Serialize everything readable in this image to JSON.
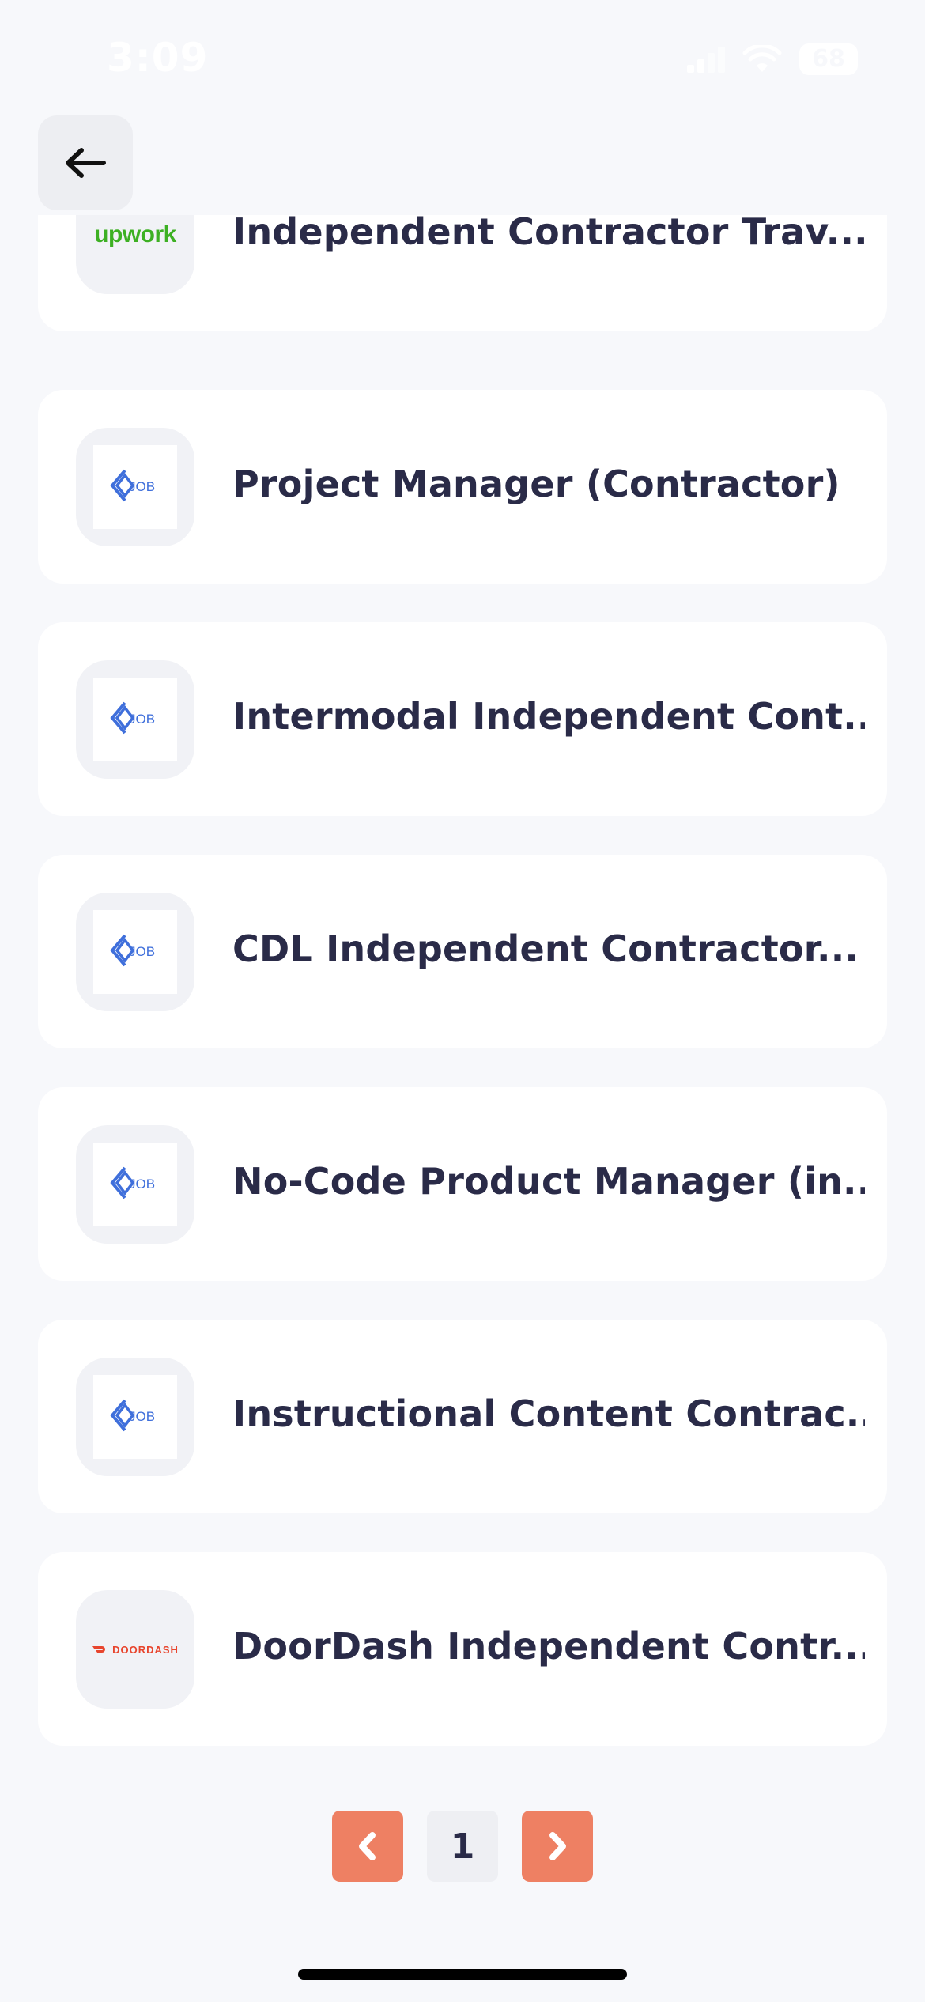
{
  "status_bar": {
    "time": "3:09",
    "battery": "68"
  },
  "header": {
    "back_icon": "arrow-left-icon"
  },
  "jobs": [
    {
      "title": "Independent Contractor Trav...",
      "logo": "upwork",
      "logo_text": "upwork"
    },
    {
      "title": "Project Manager (Contractor)",
      "logo": "job",
      "logo_text": "JOB"
    },
    {
      "title": "Intermodal Independent Cont...",
      "logo": "job",
      "logo_text": "JOB"
    },
    {
      "title": "CDL Independent Contractor...",
      "logo": "job",
      "logo_text": "JOB"
    },
    {
      "title": "No-Code Product Manager (in...",
      "logo": "job",
      "logo_text": "JOB"
    },
    {
      "title": "Instructional Content Contrac...",
      "logo": "job",
      "logo_text": "JOB"
    },
    {
      "title": "DoorDash Independent Contr...",
      "logo": "doordash",
      "logo_text": "DOORDASH"
    }
  ],
  "pagination": {
    "current_page": "1",
    "prev_icon": "chevron-left-icon",
    "next_icon": "chevron-right-icon"
  },
  "colors": {
    "background": "#F7F8FB",
    "card": "#FFFFFF",
    "title_text": "#2A2B48",
    "accent": "#EE8063",
    "job_logo_blue": "#3F6FDB",
    "upwork_green": "#3DB023",
    "doordash_red": "#E8452D"
  }
}
